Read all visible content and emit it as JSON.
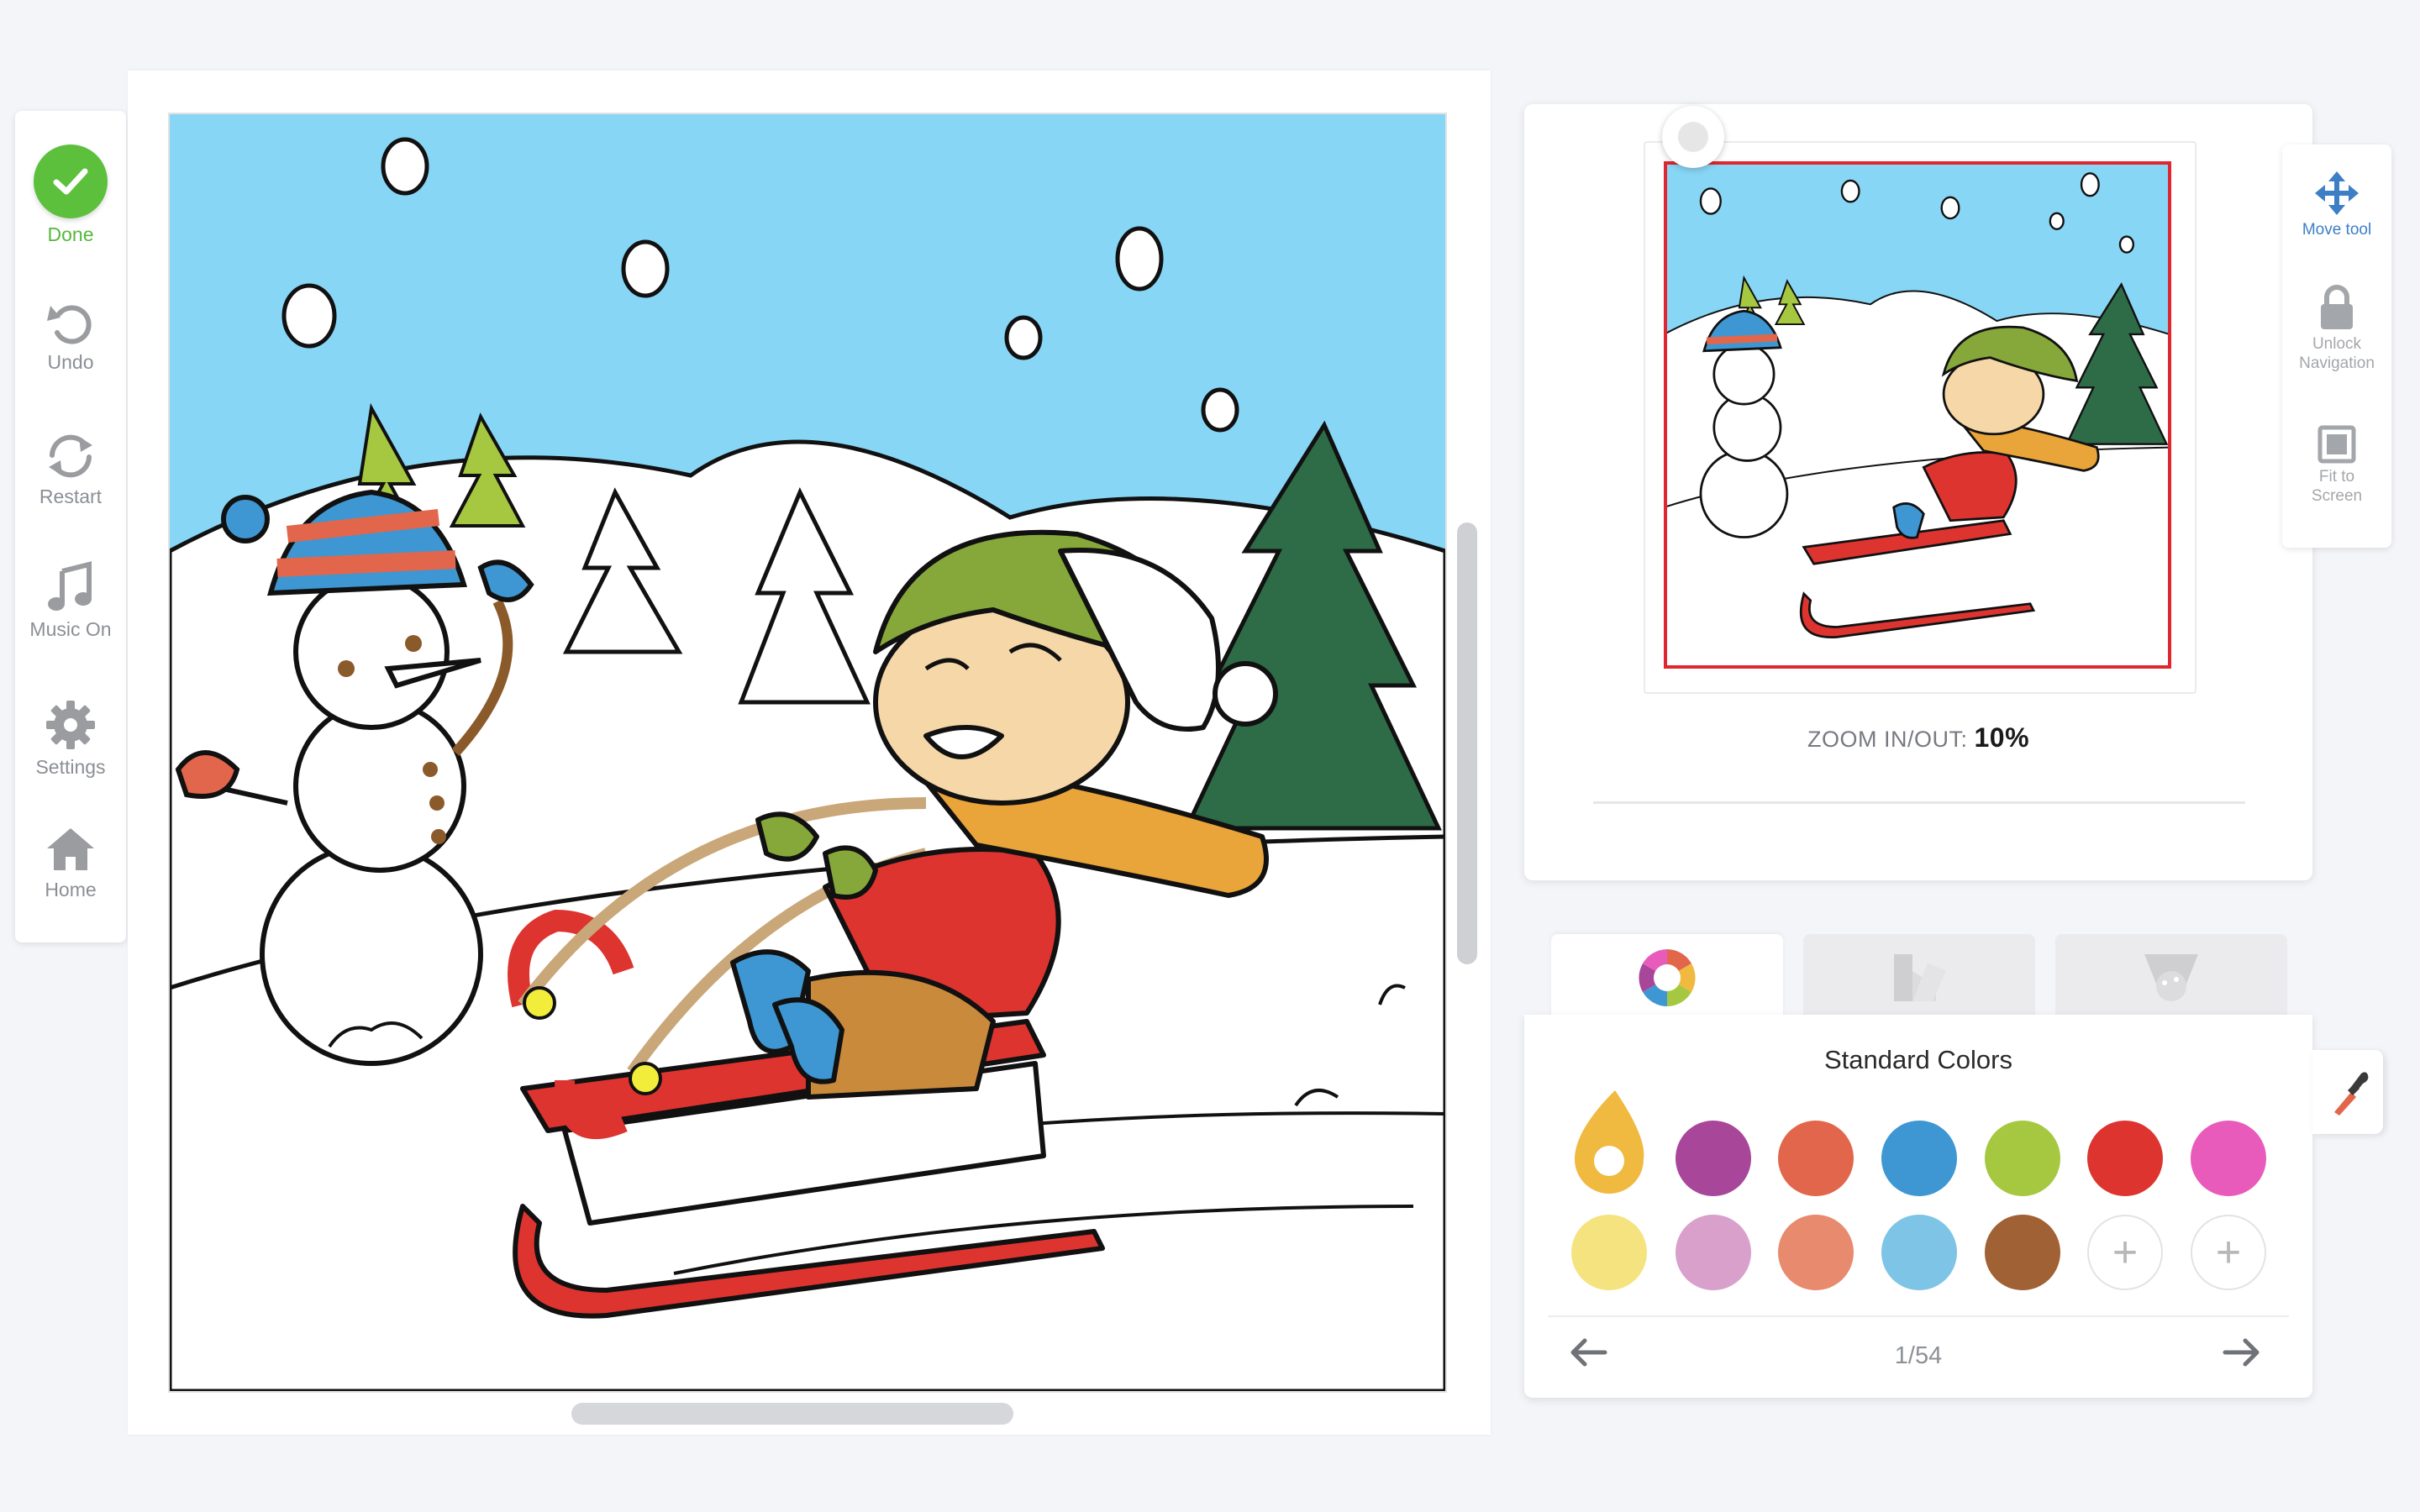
{
  "left_toolbar": {
    "done": "Done",
    "undo": "Undo",
    "restart": "Restart",
    "music": "Music On",
    "settings": "Settings",
    "home": "Home"
  },
  "navigator": {
    "zoom_label": "ZOOM IN/OUT:",
    "zoom_value": "10%"
  },
  "right_tools": {
    "move": "Move tool",
    "unlock_line1": "Unlock",
    "unlock_line2": "Navigation",
    "fit_line1": "Fit to",
    "fit_line2": "Screen"
  },
  "tabs": [
    {
      "icon": "color-wheel-icon",
      "active": true
    },
    {
      "icon": "gradient-palette-icon",
      "active": false
    },
    {
      "icon": "pattern-cup-icon",
      "active": false
    }
  ],
  "colors": {
    "title": "Standard Colors",
    "pager": "1/54",
    "row1": [
      "#f0b93f",
      "#a8469a",
      "#e2664b",
      "#3e97d2",
      "#a6c840",
      "#dd3430",
      "#e85bbb"
    ],
    "row2": [
      "#f5e380",
      "#d8a0cb",
      "#e88a6d",
      "#7ec4e6",
      "#a06134",
      "add",
      "add"
    ]
  },
  "theme": {
    "accent_green": "#5cc03d",
    "accent_blue": "#3d7fc5",
    "viewport_red": "#e0262f"
  }
}
